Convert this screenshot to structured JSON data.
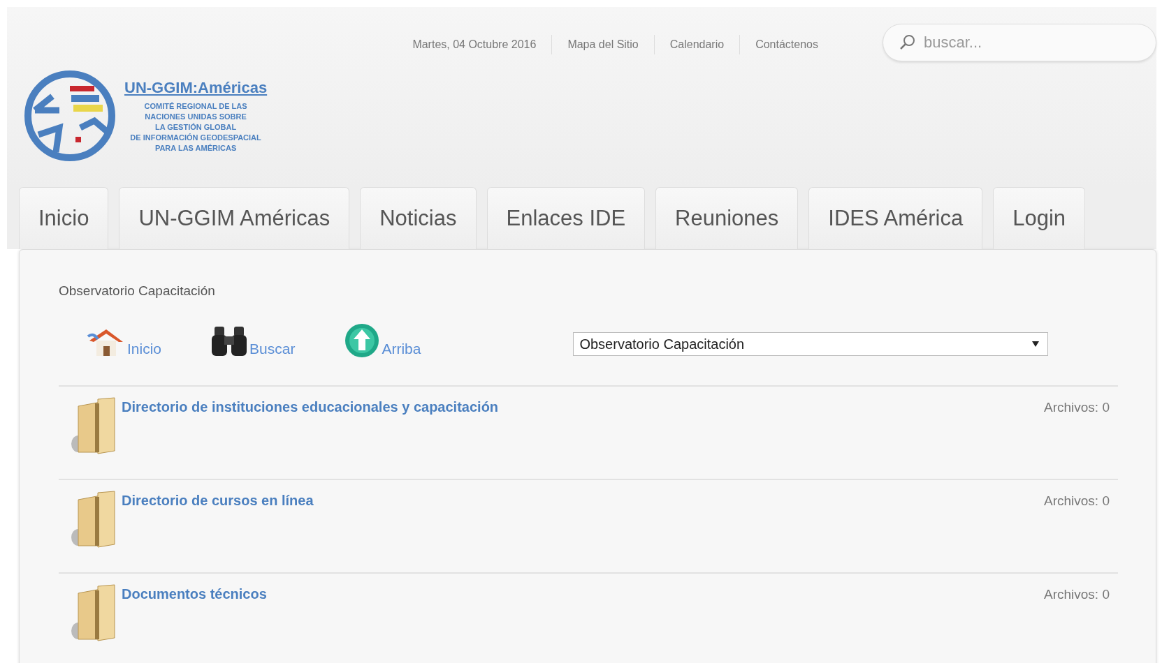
{
  "top_links": [
    "Martes, 04 Octubre 2016",
    "Mapa del Sitio",
    "Calendario",
    "Contáctenos"
  ],
  "search": {
    "placeholder": "buscar..."
  },
  "logo": {
    "title": "UN-GGIM:Américas",
    "subtitle": [
      "COMITÉ REGIONAL DE LAS",
      "NACIONES UNIDAS SOBRE",
      "LA GESTIÓN GLOBAL",
      "DE INFORMACIÓN GEODESPACIAL",
      "PARA LAS AMÉRICAS"
    ]
  },
  "tabs": [
    "Inicio",
    "UN-GGIM Américas",
    "Noticias",
    "Enlaces IDE",
    "Reuniones",
    "IDES América",
    "Login"
  ],
  "breadcrumb": "Observatorio Capacitación",
  "toolbar": [
    {
      "kind": "home",
      "label": "Inicio"
    },
    {
      "kind": "search",
      "label": "Buscar"
    },
    {
      "kind": "up",
      "label": "Arriba"
    }
  ],
  "folder_select": {
    "value": "Observatorio Capacitación"
  },
  "folders": [
    {
      "title": "Directorio de instituciones educacionales y capacitación",
      "count": "Archivos: 0"
    },
    {
      "title": "Directorio de cursos en línea",
      "count": "Archivos: 0"
    },
    {
      "title": "Documentos técnicos",
      "count": "Archivos: 0"
    }
  ]
}
